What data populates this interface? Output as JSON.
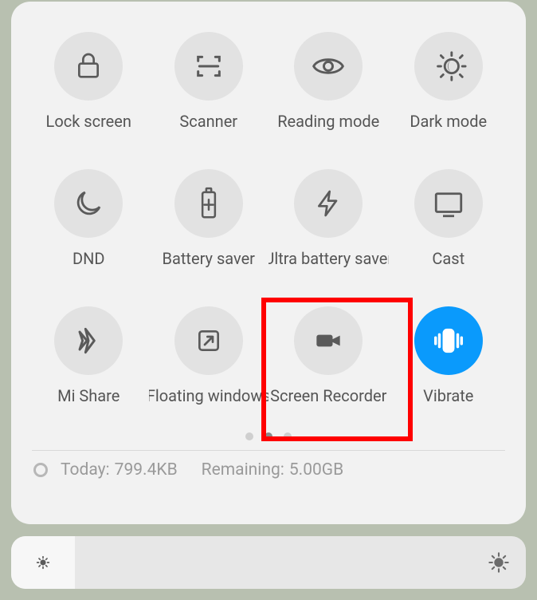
{
  "tiles": [
    {
      "key": "lock-screen",
      "label": "Lock screen",
      "icon": "lock-icon",
      "active": false
    },
    {
      "key": "scanner",
      "label": "Scanner",
      "icon": "scanner-icon",
      "active": false
    },
    {
      "key": "reading-mode",
      "label": "Reading mode",
      "icon": "eye-icon",
      "active": false
    },
    {
      "key": "dark-mode",
      "label": "Dark mode",
      "icon": "dark-mode-icon",
      "active": false
    },
    {
      "key": "dnd",
      "label": "DND",
      "icon": "moon-icon",
      "active": false
    },
    {
      "key": "battery-saver",
      "label": "Battery saver",
      "icon": "battery-plus-icon",
      "active": false
    },
    {
      "key": "ultra-battery",
      "label": "Ultra battery saver",
      "icon": "bolt-icon",
      "active": false
    },
    {
      "key": "cast",
      "label": "Cast",
      "icon": "cast-icon",
      "active": false
    },
    {
      "key": "mi-share",
      "label": "Mi Share",
      "icon": "mi-share-icon",
      "active": false
    },
    {
      "key": "floating-windows",
      "label": "Floating windows",
      "icon": "floating-window-icon",
      "active": false
    },
    {
      "key": "screen-recorder",
      "label": "Screen Recorder",
      "icon": "video-camera-icon",
      "active": false,
      "highlighted": true
    },
    {
      "key": "vibrate",
      "label": "Vibrate",
      "icon": "vibrate-icon",
      "active": true
    }
  ],
  "pagination": {
    "count": 3,
    "active_index": 1
  },
  "data_usage": {
    "today_label": "Today:",
    "today_value": "799.4KB",
    "remaining_label": "Remaining:",
    "remaining_value": "5.00GB"
  },
  "brightness": {
    "value": 0
  },
  "colors": {
    "accent": "#0a9afc",
    "highlight": "#ff0000"
  }
}
